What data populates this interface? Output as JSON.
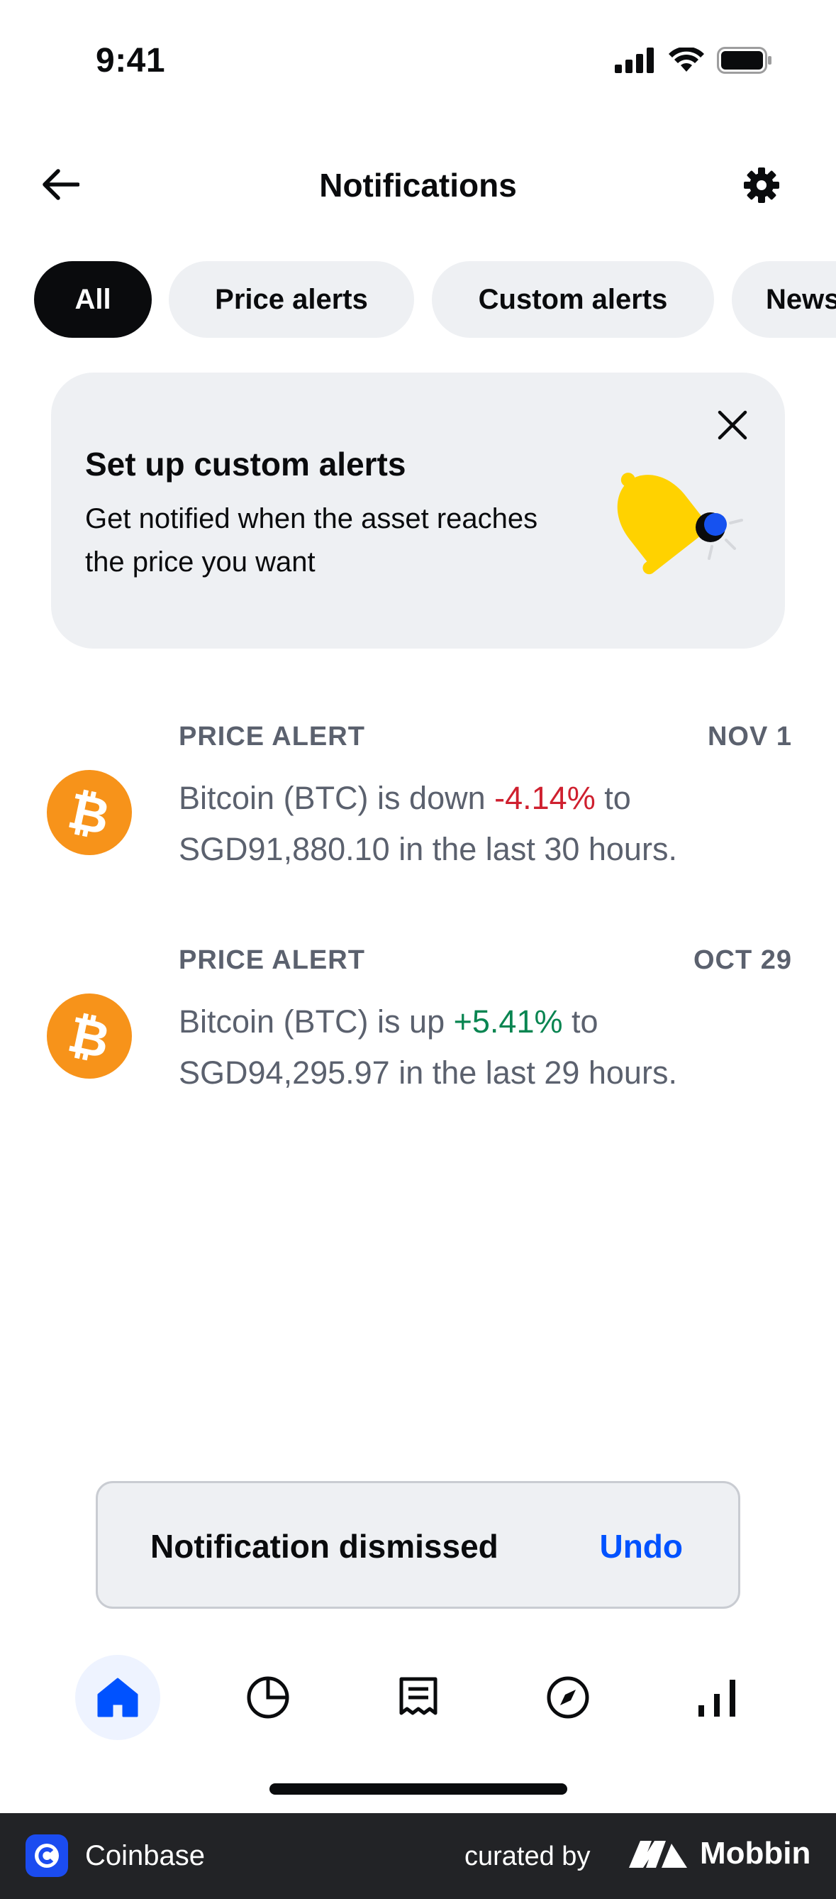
{
  "status_bar": {
    "time": "9:41"
  },
  "header": {
    "title": "Notifications"
  },
  "filters": {
    "items": [
      {
        "label": "All",
        "active": true
      },
      {
        "label": "Price alerts",
        "active": false
      },
      {
        "label": "Custom alerts",
        "active": false
      },
      {
        "label": "News",
        "active": false
      }
    ]
  },
  "promo": {
    "title": "Set up custom alerts",
    "body": "Get notified when the asset reaches the price you want"
  },
  "notifications": [
    {
      "label": "PRICE ALERT",
      "date": "NOV 1",
      "text_before": "Bitcoin (BTC) is down ",
      "change": "-4.14%",
      "text_after": " to SGD91,880.10 in the last 30 hours.",
      "direction": "down"
    },
    {
      "label": "PRICE ALERT",
      "date": "OCT 29",
      "text_before": "Bitcoin (BTC) is up ",
      "change": "+5.41%",
      "text_after": " to SGD94,295.97 in the last 29 hours.",
      "direction": "up"
    }
  ],
  "toast": {
    "message": "Notification dismissed",
    "action": "Undo"
  },
  "bottom_nav": {
    "items": [
      {
        "icon": "home-icon",
        "active": true
      },
      {
        "icon": "portfolio-icon",
        "active": false
      },
      {
        "icon": "news-icon",
        "active": false
      },
      {
        "icon": "explore-icon",
        "active": false
      },
      {
        "icon": "markets-icon",
        "active": false
      }
    ]
  },
  "footer": {
    "app_name": "Coinbase",
    "curated_by": "curated by",
    "brand": "Mobbin"
  },
  "colors": {
    "accent": "#0052ff",
    "negative": "#cf202f",
    "positive": "#098551",
    "bitcoin": "#f7931a",
    "bell": "#ffd200"
  }
}
